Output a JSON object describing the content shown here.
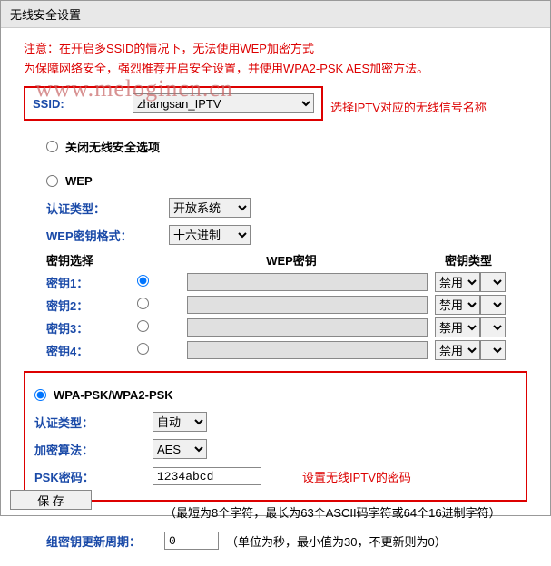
{
  "title": "无线安全设置",
  "notice_line1": "注意：在开启多SSID的情况下，无法使用WEP加密方式",
  "notice_line2": "为保障网络安全，强烈推荐开启安全设置，并使用WPA2-PSK AES加密方法。",
  "watermark": "www.melogincn.cn",
  "ssid": {
    "label": "SSID:",
    "value": "zhangsan_IPTV",
    "hint": "选择IPTV对应的无线信号名称"
  },
  "opt_disable": "关闭无线安全选项",
  "wep": {
    "title": "WEP",
    "auth_label": "认证类型：",
    "auth_value": "开放系统",
    "fmt_label": "WEP密钥格式：",
    "fmt_value": "十六进制",
    "key_select": "密钥选择",
    "wep_key_hdr": "WEP密钥",
    "key_type_hdr": "密钥类型",
    "keys": [
      {
        "label": "密钥1：",
        "disabled": "禁用"
      },
      {
        "label": "密钥2：",
        "disabled": "禁用"
      },
      {
        "label": "密钥3：",
        "disabled": "禁用"
      },
      {
        "label": "密钥4：",
        "disabled": "禁用"
      }
    ]
  },
  "wpa": {
    "title": "WPA-PSK/WPA2-PSK",
    "auth_label": "认证类型：",
    "auth_value": "自动",
    "algo_label": "加密算法：",
    "algo_value": "AES",
    "psk_label": "PSK密码：",
    "psk_value": "1234abcd",
    "psk_hint": "设置无线IPTV的密码",
    "psk_paren": "（最短为8个字符，最长为63个ASCII码字符或64个16进制字符）"
  },
  "group_key": {
    "label": "组密钥更新周期：",
    "value": "0",
    "hint": "（单位为秒，最小值为30，不更新则为0）"
  },
  "save": "保 存"
}
